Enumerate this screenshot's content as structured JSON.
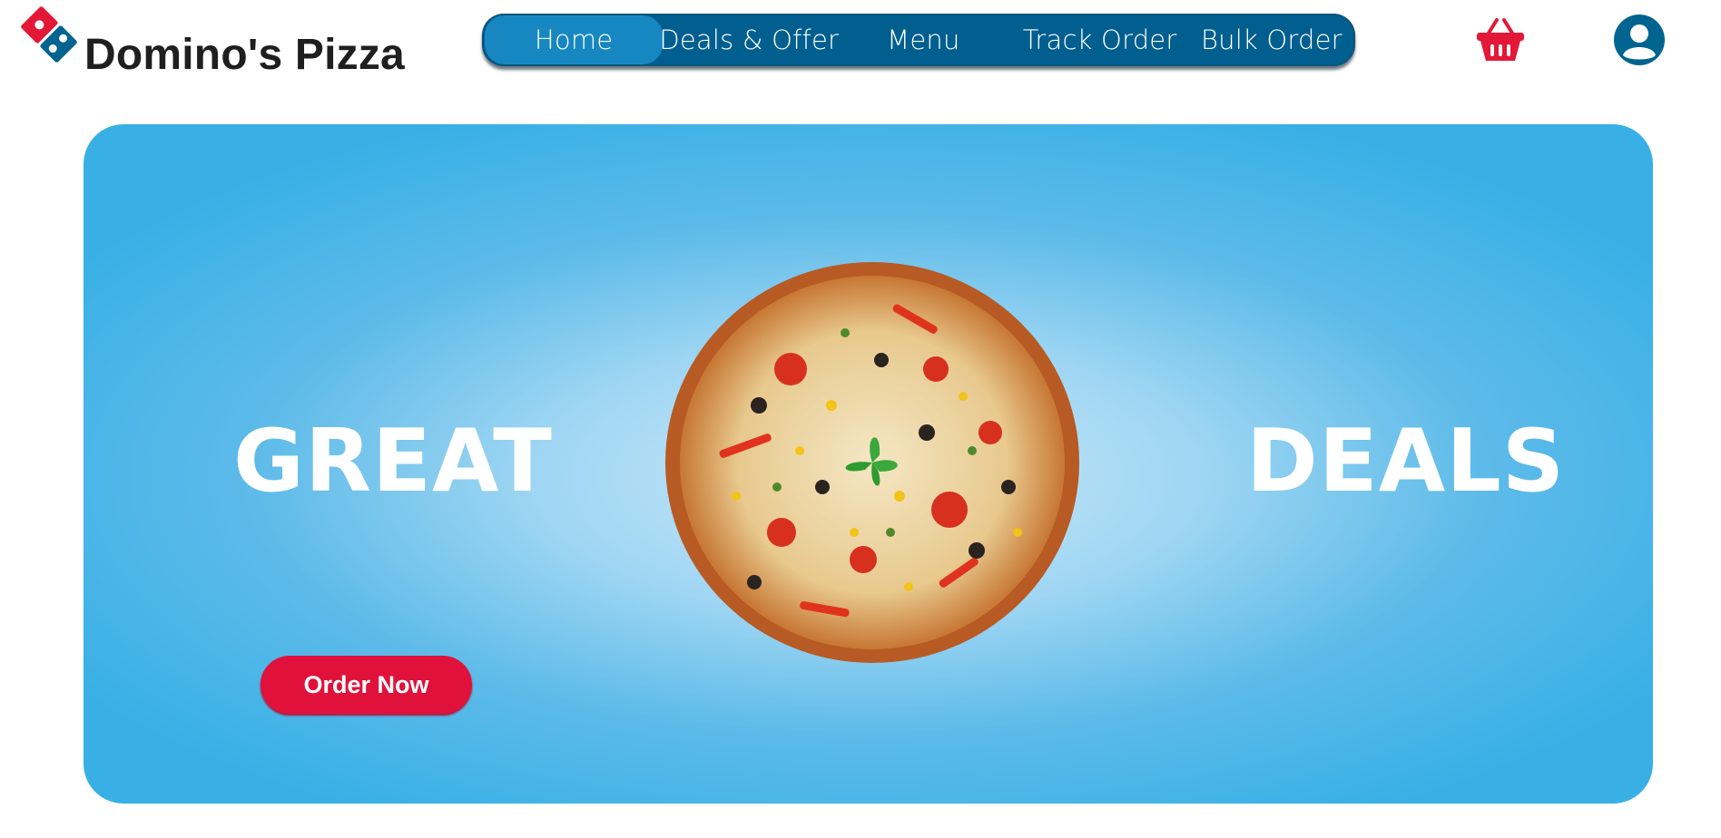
{
  "brand": {
    "name": "Domino's Pizza",
    "logo_icon": "dominos-logo-icon"
  },
  "nav": {
    "items": [
      {
        "label": "Home",
        "active": true
      },
      {
        "label": "Deals & Offer",
        "active": false
      },
      {
        "label": "Menu",
        "active": false
      },
      {
        "label": "Track Order",
        "active": false
      },
      {
        "label": "Bulk Order",
        "active": false
      }
    ]
  },
  "header_icons": {
    "cart": "shopping-basket-icon",
    "account": "user-account-icon"
  },
  "hero": {
    "left_text": "GREAT",
    "right_text": "DEALS",
    "image": "pizza-image",
    "cta_label": "Order Now"
  },
  "colors": {
    "nav_bg": "#015f8f",
    "nav_active": "#1787c2",
    "hero_blue": "#38b0e6",
    "cta_red": "#e0123b",
    "brand_red": "#e31837",
    "brand_blue": "#006491"
  }
}
